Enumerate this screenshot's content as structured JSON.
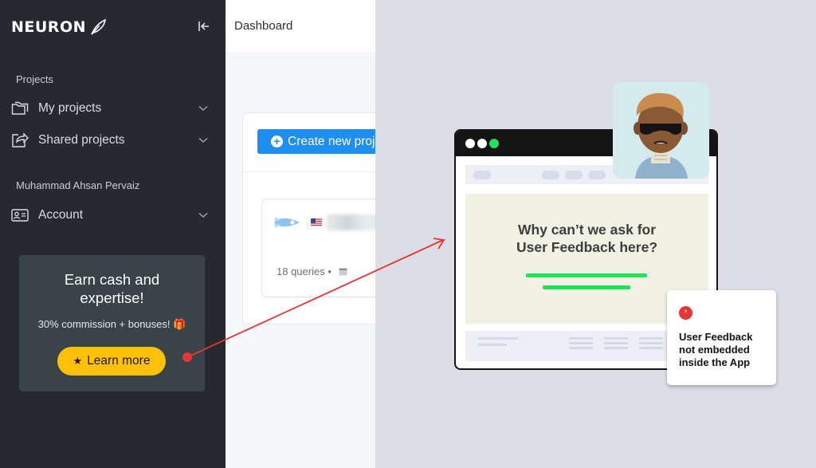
{
  "app": {
    "logo_text": "NEURON"
  },
  "sidebar": {
    "section_projects": "Projects",
    "items": [
      {
        "label": "My projects",
        "icon": "folders-icon"
      },
      {
        "label": "Shared projects",
        "icon": "share-icon"
      }
    ],
    "user_name": "Muhammad Ahsan Pervaiz",
    "account_label": "Account"
  },
  "promo": {
    "title": "Earn cash and expertise!",
    "subtitle": "30% commission + bonuses! 🎁",
    "button_label": "Learn more"
  },
  "header": {
    "title": "Dashboard"
  },
  "main": {
    "create_button": "Create new project",
    "project": {
      "queries": "18 queries •"
    }
  },
  "illustration": {
    "headline_line1": "Why can’t we ask for",
    "headline_line2": "User Feedback here?",
    "notice_icon": "*",
    "notice_text": "User Feedback not embedded inside the App"
  },
  "colors": {
    "sidebar_bg": "#262a2e",
    "accent_yellow": "#ffc107",
    "primary_blue": "#1f8ef1",
    "alert_red": "#e53535",
    "highlight_green": "#22e05a"
  }
}
